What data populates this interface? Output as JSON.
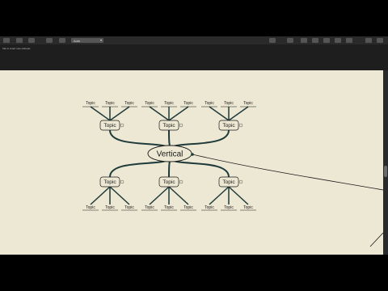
{
  "toolbar": {
    "style_value": "Auto",
    "buttons_left": [
      "new-icon",
      "open-icon",
      "save-icon",
      "undo-icon",
      "redo-icon",
      "style-icon"
    ],
    "buttons_right": [
      "topic-icon",
      "subtopic-icon",
      "relation-icon",
      "note-icon",
      "image-icon",
      "present-icon",
      "share-icon",
      "panel-icon"
    ]
  },
  "hint": "Tab to insert new subtopic",
  "map": {
    "central_topic": "Vertical",
    "main_topic_label": "Topic",
    "sub_topic_label": "Topic",
    "colors": {
      "canvas": "#ece8d3",
      "line": "#1f3a3a",
      "node_fill": "#ece8d3"
    }
  }
}
